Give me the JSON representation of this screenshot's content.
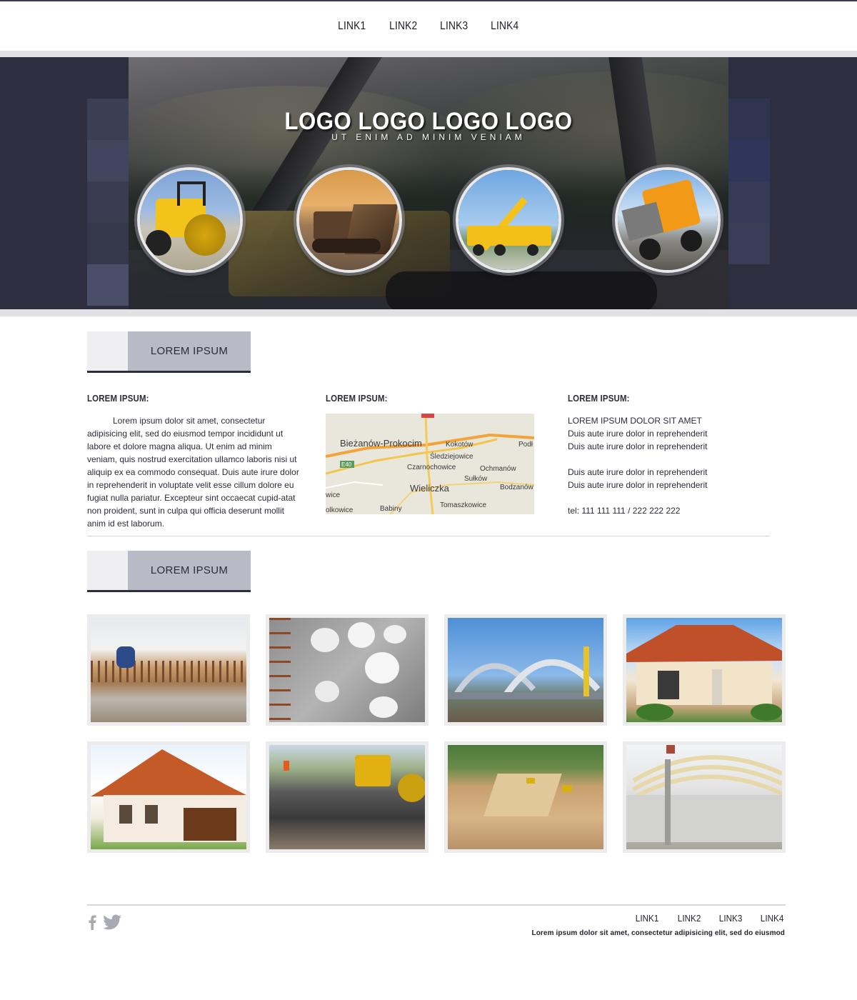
{
  "nav": {
    "links": [
      "LINK1",
      "LINK2",
      "LINK3",
      "LINK4"
    ]
  },
  "hero": {
    "logo": "LOGO LOGO LOGO LOGO",
    "tagline": "UT ENIM AD MINIM VENIAM",
    "circles": [
      {
        "icon": "road-roller-image"
      },
      {
        "icon": "bulldozer-image"
      },
      {
        "icon": "crane-truck-image"
      },
      {
        "icon": "dump-truck-image"
      }
    ]
  },
  "section1": {
    "title": "LOREM IPSUM",
    "col1": {
      "title": "LOREM IPSUM:",
      "text": "Lorem ipsum dolor sit amet, consectetur adipisicing elit, sed do eiusmod tempor incididunt ut labore et dolore magna aliqua. Ut enim ad minim veniam, quis nostrud exercitation ullamco laboris nisi ut aliquip ex ea commodo consequat. Duis aute irure dolor in reprehenderit in voluptate velit esse cillum dolore eu fugiat nulla pariatur. Excepteur sint occaecat cupid-atat non proident, sunt in culpa qui officia deserunt mollit anim id est laborum."
    },
    "col2": {
      "title": "LOREM IPSUM:",
      "map": {
        "labels": [
          "Bieżanów-Prokocim",
          "Kokotów",
          "Śledziejowice",
          "Czarnochowice",
          "Ochmanów",
          "Sułków",
          "Wieliczka",
          "Bodzanów",
          "Babiny",
          "Tomaszkowice",
          "Podł",
          "wice",
          "olkowice",
          "E40"
        ]
      }
    },
    "col3": {
      "title": "LOREM IPSUM:",
      "line1": "LOREM IPSUM DOLOR SIT AMET",
      "line2": "Duis aute irure dolor in reprehenderit",
      "line3": "Duis aute irure dolor in reprehenderit",
      "line4": "Duis aute irure dolor in reprehenderit",
      "line5": "Duis aute irure dolor in reprehenderit",
      "phone": "tel: 111 111 111 / 222 222 222"
    }
  },
  "section2": {
    "title": "LOREM IPSUM",
    "gallery": [
      {
        "icon": "rebar-worker-image"
      },
      {
        "icon": "concrete-wall-openings-image"
      },
      {
        "icon": "arch-bridge-image"
      },
      {
        "icon": "villa-house-image"
      },
      {
        "icon": "tiled-roof-house-image"
      },
      {
        "icon": "road-paving-image"
      },
      {
        "icon": "earthworks-site-image"
      },
      {
        "icon": "hall-structure-image"
      }
    ]
  },
  "footer": {
    "links": [
      "LINK1",
      "LINK2",
      "LINK3",
      "LINK4"
    ],
    "copy": "Lorem ipsum dolor sit amet, consectetur adipisicing elit, sed do eiusmod",
    "social": [
      "facebook-icon",
      "twitter-icon"
    ]
  },
  "colors": {
    "hero_dark": "#2d2f40",
    "header_accent": "#b9bac6",
    "header_bar": "#2c2e3e"
  }
}
